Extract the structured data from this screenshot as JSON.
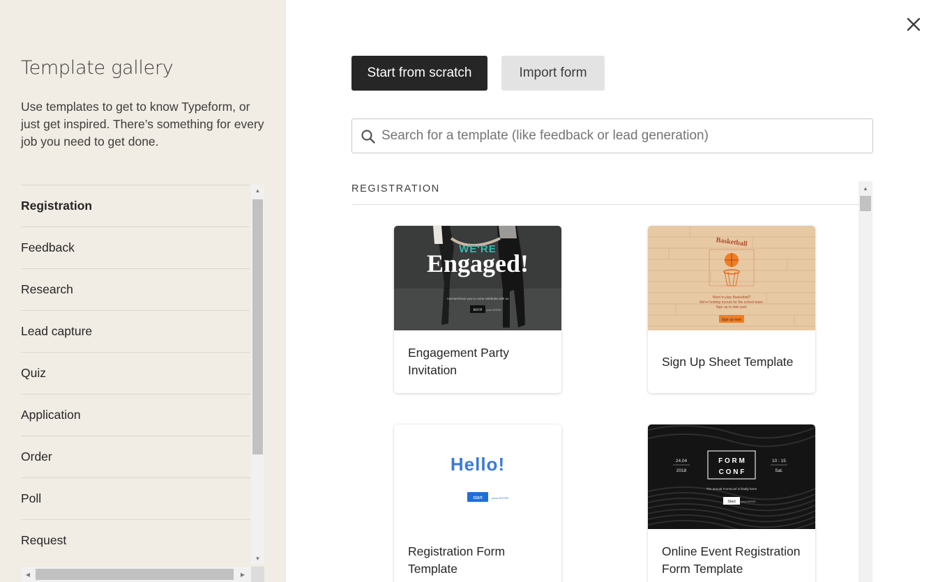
{
  "sidebar": {
    "title": "Template gallery",
    "description": "Use templates to get to know Typeform, or just get inspired. There’s something for every job you need to get done.",
    "categories": [
      {
        "label": "Registration",
        "active": true
      },
      {
        "label": "Feedback"
      },
      {
        "label": "Research"
      },
      {
        "label": "Lead capture"
      },
      {
        "label": "Quiz"
      },
      {
        "label": "Application"
      },
      {
        "label": "Order"
      },
      {
        "label": "Poll"
      },
      {
        "label": "Request"
      }
    ]
  },
  "actions": {
    "start_label": "Start from scratch",
    "import_label": "Import form"
  },
  "search": {
    "placeholder": "Search for a template (like feedback or lead generation)",
    "value": ""
  },
  "section": {
    "title": "REGISTRATION"
  },
  "templates": [
    {
      "name": "Engagement Party Invitation",
      "thumb": {
        "line1": "WE'RE",
        "line2": "Engaged!",
        "caption": "And we'd love you to come celebrate with us",
        "button": "RSVP",
        "hint": "press ENTER"
      }
    },
    {
      "name": "Sign Up Sheet Template",
      "thumb": {
        "title": "Basketball",
        "line1": "Want to play Basketball?",
        "line2": "We're holding tryouts for the school team.",
        "line3": "Sign up to take part.",
        "button": "Sign up now!"
      }
    },
    {
      "name": "Registration Form Template",
      "thumb": {
        "title": "Hello!",
        "button": "start",
        "hint": "press ENTER"
      }
    },
    {
      "name": "Online Event Registration Form Template",
      "thumb": {
        "date": "24.04",
        "year": "2018",
        "brand1": "F O R M",
        "brand2": "C O N F",
        "time": "10 : 15",
        "day": "Sat.",
        "caption": "The annual FormConf is finally here!",
        "button": "Start",
        "hint": "press ENTER"
      }
    }
  ],
  "colors": {
    "sidebar_bg": "#f1ece4",
    "primary_button": "#262627",
    "secondary_button": "#e3e3e3",
    "hello_blue": "#3d7ad6",
    "basketball_orange": "#f27d21"
  }
}
